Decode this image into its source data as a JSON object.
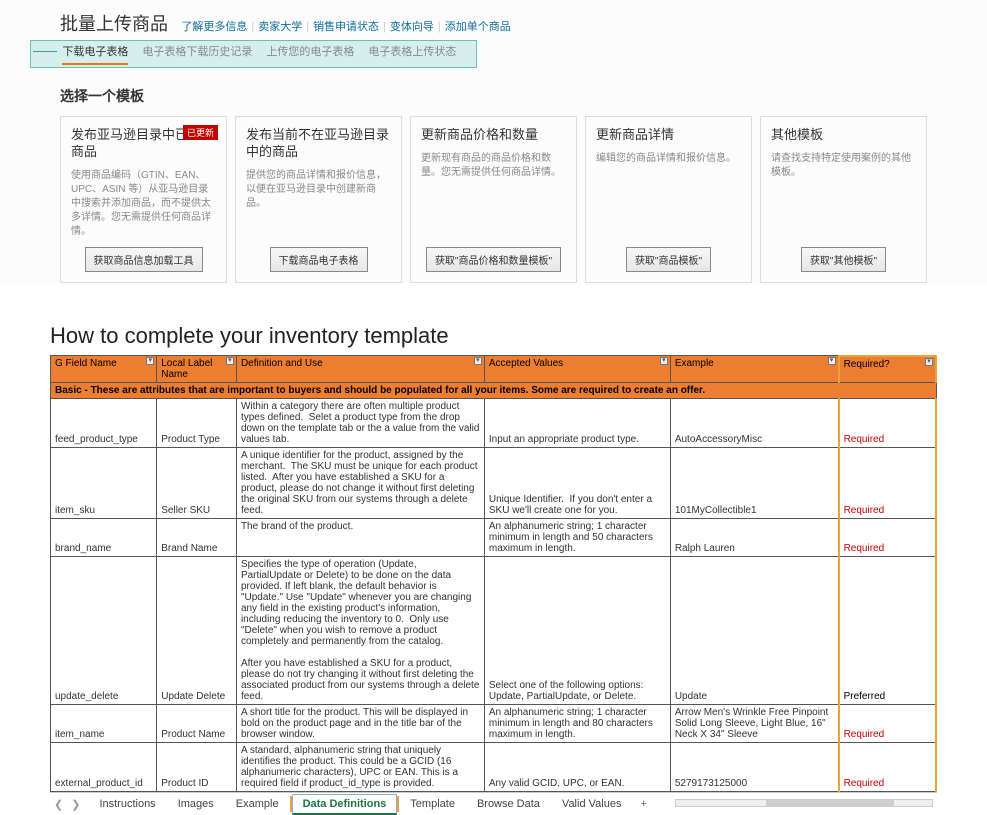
{
  "header": {
    "title": "批量上传商品",
    "links": [
      "了解更多信息",
      "卖家大学",
      "销售申请状态",
      "变体向导",
      "添加单个商品"
    ],
    "subtabs": [
      "下载电子表格",
      "电子表格下载历史记录",
      "上传您的电子表格",
      "电子表格上传状态"
    ],
    "active_subtab": "下载电子表格"
  },
  "section_title": "选择一个模板",
  "cards": [
    {
      "title": "发布亚马逊目录中已有的商品",
      "desc": "使用商品编码（GTIN、EAN、UPC、ASIN 等）从亚马逊目录中搜索并添加商品，而不提供太多详情。您无需提供任何商品详情。",
      "btn": "获取商品信息加载工具",
      "badge": "已更新"
    },
    {
      "title": "发布当前不在亚马逊目录中的商品",
      "desc": "提供您的商品详情和报价信息，以便在亚马逊目录中创建新商品。",
      "btn": "下载商品电子表格"
    },
    {
      "title": "更新商品价格和数量",
      "desc": "更新现有商品的商品价格和数量。您无需提供任何商品详情。",
      "btn": "获取\"商品价格和数量模板\""
    },
    {
      "title": "更新商品详情",
      "desc": "编辑您的商品详情和报价信息。",
      "btn": "获取\"商品模板\""
    },
    {
      "title": "其他模板",
      "desc": "请查找支持特定使用案例的其他模板。",
      "btn": "获取\"其他模板\""
    }
  ],
  "excel": {
    "title": "How to complete your inventory template",
    "headers": [
      "G Field Name",
      "Local Label Name",
      "Definition and Use",
      "Accepted Values",
      "Example",
      "Required?"
    ],
    "section_row": "Basic - These are attributes that are important to buyers and should be populated for all your items. Some are required to create an offer.",
    "rows": [
      {
        "field": "feed_product_type",
        "label": "Product Type",
        "def": "Within a category there are often multiple product types defined.  Selet a product type from the drop down on the template tab or the a value from the valid values tab.",
        "accepted": "Input an appropriate product type.",
        "example": "AutoAccessoryMisc",
        "req": "Required",
        "req_class": "required-col"
      },
      {
        "field": "item_sku",
        "label": "Seller SKU",
        "def": "A unique identifier for the product, assigned by the merchant.  The SKU must be unique for each product listed.  After you have established a SKU for a product, please do not change it without first deleting the original SKU from our systems through a delete feed.",
        "accepted": "Unique Identifier.  If you don't enter a SKU we'll create one for you.",
        "example": "101MyCollectible1",
        "req": "Required",
        "req_class": "required-col"
      },
      {
        "field": "brand_name",
        "label": "Brand Name",
        "def": "The brand of the product.",
        "accepted": "An alphanumeric string; 1 character minimum in length and 50 characters maximum in length.",
        "example": "Ralph Lauren",
        "req": "Required",
        "req_class": "required-col"
      },
      {
        "field": "update_delete",
        "label": "Update Delete",
        "def": "Specifies the type of operation (Update, PartialUpdate or Delete) to be done on the data provided. If left blank, the default behavior is \"Update.\" Use \"Update\" whenever you are changing any field in the existing product's information, including reducing the inventory to 0.  Only use \"Delete\" when you wish to remove a product completely and permanently from the catalog.\n\nAfter you have established a SKU for a product, please do not try changing it without first deleting the associated product from our systems through a delete feed.",
        "accepted": "Select one of the following options: Update, PartialUpdate, or Delete.",
        "example": "Update",
        "req": "Preferred",
        "req_class": "preferred-col"
      },
      {
        "field": "item_name",
        "label": "Product Name",
        "def": "A short title for the product. This will be displayed in bold on the product page and in the title bar of the browser window.",
        "accepted": "An alphanumeric string; 1 character minimum in length and 80 characters maximum in length.",
        "example": "Arrow Men's Wrinkle Free Pinpoint Solid Long Sleeve, Light Blue, 16\" Neck X 34\" Sleeve",
        "req": "Required",
        "req_class": "required-col"
      },
      {
        "field": "external_product_id",
        "label": "Product ID",
        "def": "A standard, alphanumeric string that uniquely identifies the product. This could be a GCID (16 alphanumeric characters), UPC or EAN. This is a required field if product_id_type is provided.",
        "accepted": "Any valid GCID, UPC, or EAN.",
        "example": "5279173125000",
        "req": "Required",
        "req_class": "required-col"
      }
    ],
    "sheet_tabs": [
      "Instructions",
      "Images",
      "Example",
      "Data Definitions",
      "Template",
      "Browse Data",
      "Valid Values"
    ],
    "active_sheet": "Data Definitions"
  }
}
